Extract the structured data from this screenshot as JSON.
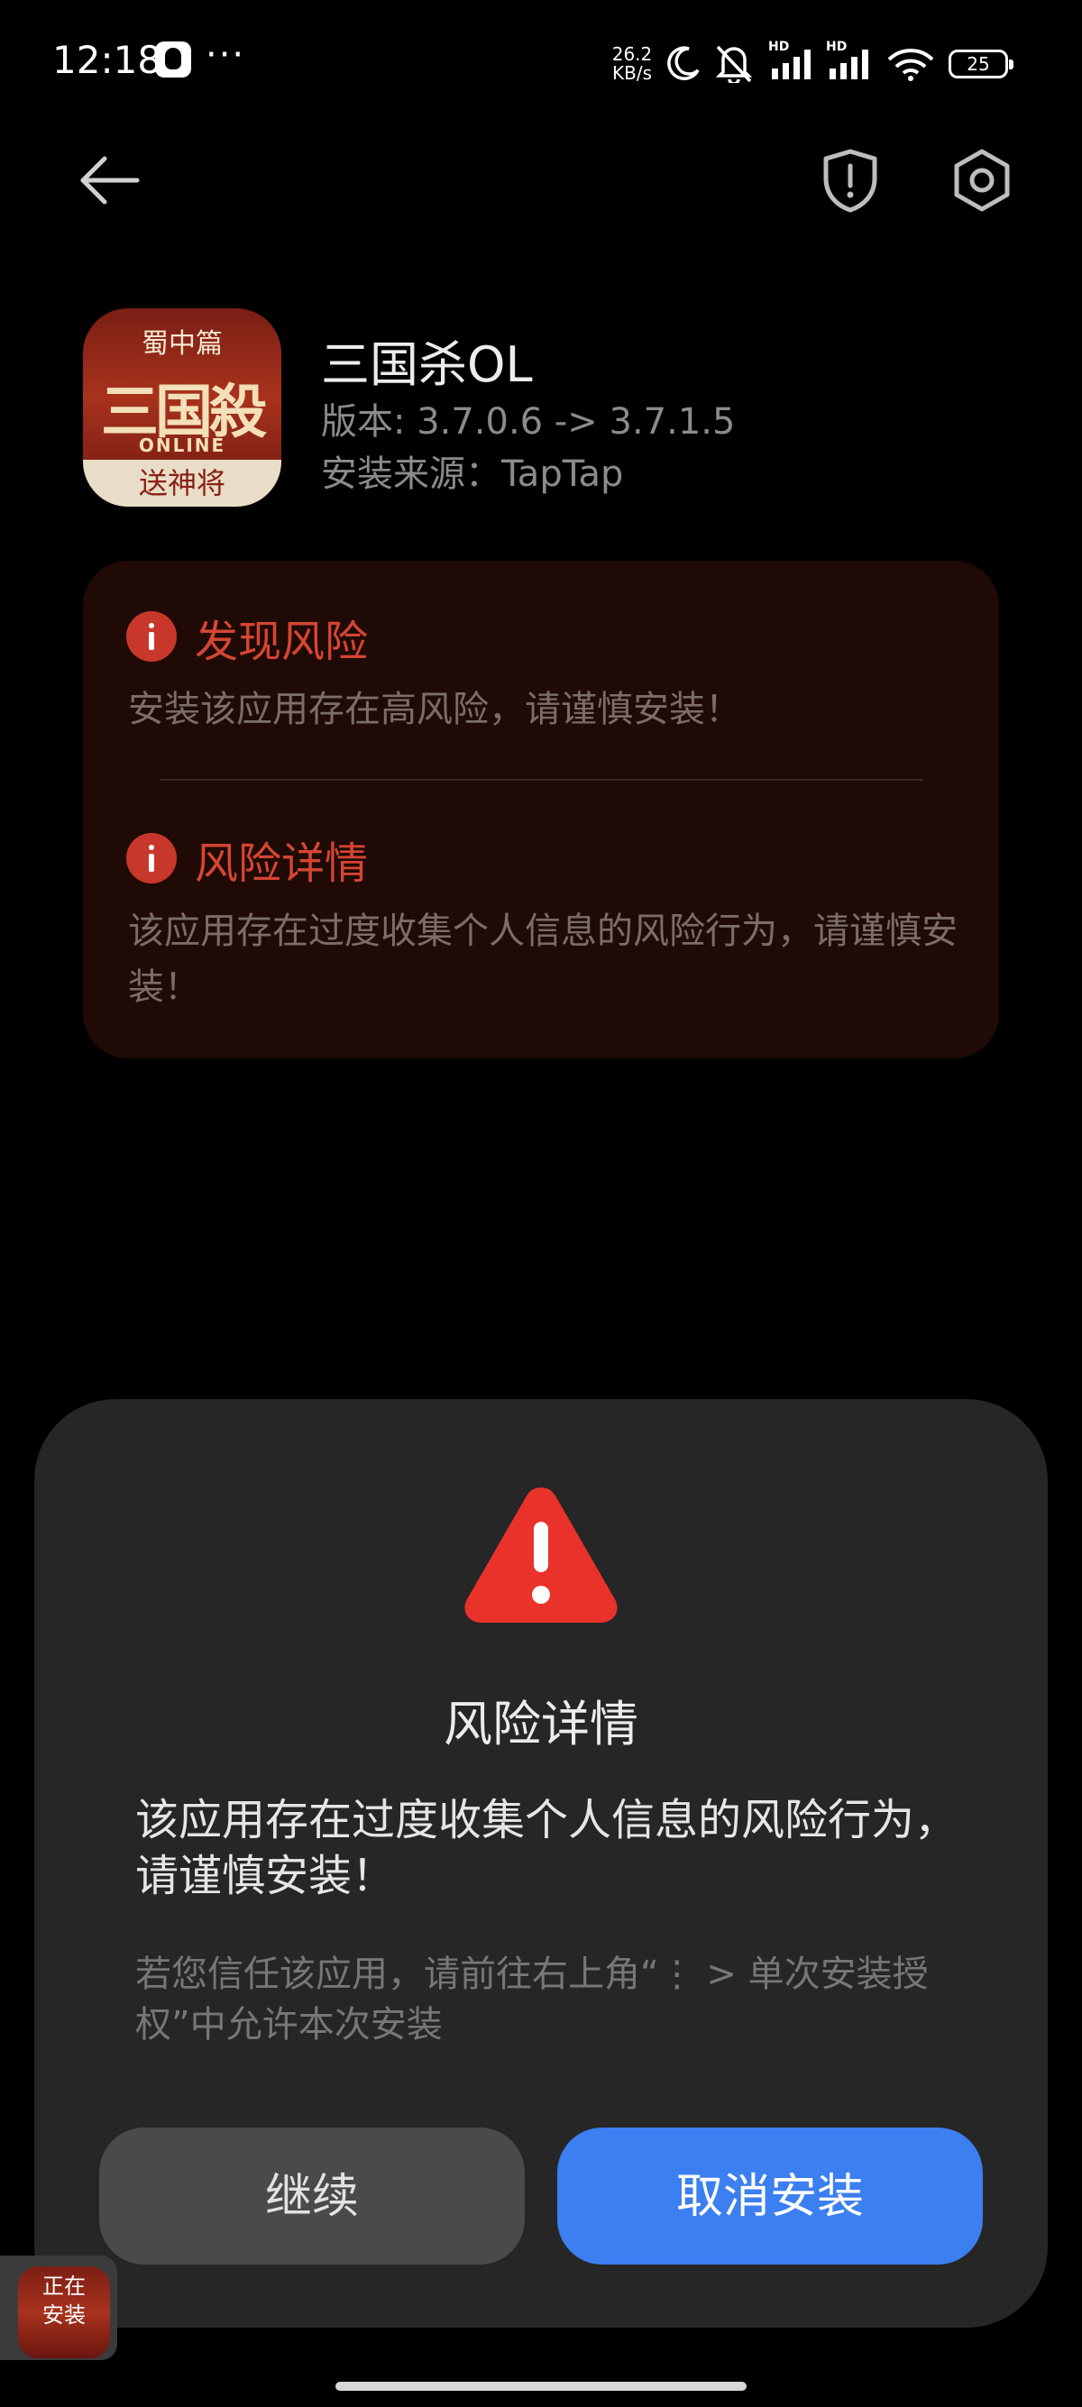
{
  "status_bar": {
    "time": "12:18",
    "more": "···",
    "net_speed_value": "26.2",
    "net_speed_unit": "KB/s",
    "hd1": "HD",
    "hd2": "HD",
    "battery": "25"
  },
  "app": {
    "name": "三国杀OL",
    "version": "版本: 3.7.0.6 -> 3.7.1.5",
    "source": "安装来源：TapTap",
    "icon_top": "蜀中篇",
    "icon_mid": "三国殺",
    "icon_online": "ONLINE",
    "icon_bottom": "送神将"
  },
  "risk_card": {
    "found_title": "发现风险",
    "found_desc": "安装该应用存在高风险，请谨慎安装！",
    "detail_title": "风险详情",
    "detail_desc": "该应用存在过度收集个人信息的风险行为，请谨慎安装！"
  },
  "dialog": {
    "title": "风险详情",
    "body": "该应用存在过度收集个人信息的风险行为，请谨慎安装！",
    "hint": "若您信任该应用，请前往右上角“⋮ > 单次安装授权”中允许本次安装",
    "continue_label": "继续",
    "cancel_label": "取消安装"
  },
  "install_bubble": {
    "line1": "正在",
    "line2": "安装"
  },
  "colors": {
    "background": "#000000",
    "risk_red": "#d64533",
    "warning_red": "#e8322a",
    "primary_blue": "#3b7ff0"
  }
}
